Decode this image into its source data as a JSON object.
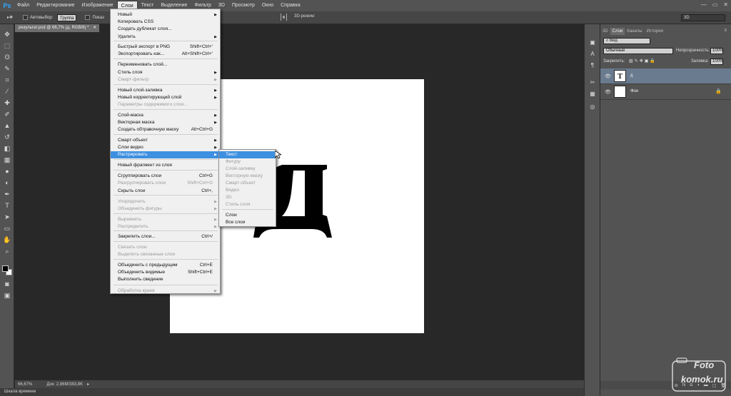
{
  "app": {
    "logo": "Ps",
    "window_buttons": [
      "—",
      "▭",
      "✕"
    ]
  },
  "menubar": {
    "items": [
      "Файл",
      "Редактирование",
      "Изображение",
      "Слои",
      "Текст",
      "Выделение",
      "Фильтр",
      "3D",
      "Просмотр",
      "Окно",
      "Справка"
    ],
    "active": "Слои"
  },
  "options_bar": {
    "auto_select_label": "Автовыбор:",
    "auto_select_value": "Группа",
    "show_controls_label": "Показ",
    "mode_3d_label": "3D-режим:",
    "workspace": "3D"
  },
  "document": {
    "tab_title": "результат.psd @ 66,7% (д, RGB/8) *",
    "close": "✕",
    "canvas_glyph": "д"
  },
  "status": {
    "zoom": "66,67%",
    "doc_info": "Док: 2,86M/383,8K",
    "timeline_label": "Шкала времени"
  },
  "layer_menu": {
    "items": [
      {
        "label": "Новый",
        "shortcut": "",
        "submenu": true,
        "disabled": false
      },
      {
        "label": "Копировать CSS",
        "shortcut": "",
        "submenu": false,
        "disabled": false
      },
      {
        "label": "Создать дубликат слоя...",
        "shortcut": "",
        "submenu": false,
        "disabled": false
      },
      {
        "label": "Удалить",
        "shortcut": "",
        "submenu": true,
        "disabled": false
      },
      {
        "label": "Быстрый экспорт в PNG",
        "shortcut": "Shift+Ctrl+'",
        "submenu": false,
        "disabled": false
      },
      {
        "label": "Экспортировать как...",
        "shortcut": "Alt+Shift+Ctrl+'",
        "submenu": false,
        "disabled": false
      },
      {
        "label": "Переименовать слой...",
        "shortcut": "",
        "submenu": false,
        "disabled": false
      },
      {
        "label": "Стиль слоя",
        "shortcut": "",
        "submenu": true,
        "disabled": false
      },
      {
        "label": "Смарт-фильтр",
        "shortcut": "",
        "submenu": true,
        "disabled": true
      },
      {
        "label": "Новый слой-заливка",
        "shortcut": "",
        "submenu": true,
        "disabled": false
      },
      {
        "label": "Новый корректирующий слой",
        "shortcut": "",
        "submenu": true,
        "disabled": false
      },
      {
        "label": "Параметры содержимого слоя...",
        "shortcut": "",
        "submenu": false,
        "disabled": true
      },
      {
        "label": "Слой-маска",
        "shortcut": "",
        "submenu": true,
        "disabled": false
      },
      {
        "label": "Векторная маска",
        "shortcut": "",
        "submenu": true,
        "disabled": false
      },
      {
        "label": "Создать обтравочную маску",
        "shortcut": "Alt+Ctrl+G",
        "submenu": false,
        "disabled": false
      },
      {
        "label": "Смарт-объект",
        "shortcut": "",
        "submenu": true,
        "disabled": false
      },
      {
        "label": "Слои видео",
        "shortcut": "",
        "submenu": true,
        "disabled": false
      },
      {
        "label": "Растрировать",
        "shortcut": "",
        "submenu": true,
        "disabled": false,
        "highlighted": true
      },
      {
        "label": "Новый фрагмент из слоя",
        "shortcut": "",
        "submenu": false,
        "disabled": false
      },
      {
        "label": "Сгруппировать слои",
        "shortcut": "Ctrl+G",
        "submenu": false,
        "disabled": false
      },
      {
        "label": "Разгруппировать слои",
        "shortcut": "Shift+Ctrl+G",
        "submenu": false,
        "disabled": true
      },
      {
        "label": "Скрыть слои",
        "shortcut": "Ctrl+,",
        "submenu": false,
        "disabled": false
      },
      {
        "label": "Упорядочить",
        "shortcut": "",
        "submenu": true,
        "disabled": true
      },
      {
        "label": "Объединить фигуры",
        "shortcut": "",
        "submenu": true,
        "disabled": true
      },
      {
        "label": "Выровнять",
        "shortcut": "",
        "submenu": true,
        "disabled": true
      },
      {
        "label": "Распределить",
        "shortcut": "",
        "submenu": true,
        "disabled": true
      },
      {
        "label": "Закрепить слои...",
        "shortcut": "Ctrl+/",
        "submenu": false,
        "disabled": false
      },
      {
        "label": "Связать слои",
        "shortcut": "",
        "submenu": false,
        "disabled": true
      },
      {
        "label": "Выделить связанные слои",
        "shortcut": "",
        "submenu": false,
        "disabled": true
      },
      {
        "label": "Объединить с предыдущим",
        "shortcut": "Ctrl+E",
        "submenu": false,
        "disabled": false
      },
      {
        "label": "Объединить видимые",
        "shortcut": "Shift+Ctrl+E",
        "submenu": false,
        "disabled": false
      },
      {
        "label": "Выполнить сведение",
        "shortcut": "",
        "submenu": false,
        "disabled": false
      },
      {
        "label": "Обработка краев",
        "shortcut": "",
        "submenu": true,
        "disabled": true
      }
    ]
  },
  "rasterize_submenu": {
    "items": [
      {
        "label": "Текст",
        "disabled": false,
        "highlighted": true
      },
      {
        "label": "Фигуру",
        "disabled": true
      },
      {
        "label": "Слой-заливку",
        "disabled": true
      },
      {
        "label": "Векторную маску",
        "disabled": true
      },
      {
        "label": "Смарт-объект",
        "disabled": true
      },
      {
        "label": "Видео",
        "disabled": true
      },
      {
        "label": "3D",
        "disabled": true
      },
      {
        "label": "Стиль слоя",
        "disabled": true
      },
      {
        "label": "Слои",
        "disabled": false
      },
      {
        "label": "Все слои",
        "disabled": false
      }
    ]
  },
  "layers_panel": {
    "tabs": [
      "3D",
      "Слои",
      "Каналы",
      "История"
    ],
    "active_tab": "Слои",
    "filter_kind": "Вид",
    "blend_mode": "Обычные",
    "opacity_label": "Непрозрачность:",
    "opacity_value": "100%",
    "lock_label": "Закрепить:",
    "fill_label": "Заливка:",
    "fill_value": "100%",
    "layers": [
      {
        "name": "д",
        "type": "text",
        "thumb": "T",
        "selected": true,
        "locked": false
      },
      {
        "name": "Фон",
        "type": "background",
        "thumb": "",
        "selected": false,
        "locked": true
      }
    ],
    "footer_icons": [
      "link-icon",
      "fx-icon",
      "mask-icon",
      "adjustment-icon",
      "folder-icon",
      "new-layer-icon",
      "trash-icon"
    ],
    "footer_labels": [
      "⊖",
      "fx",
      "◘",
      "◑",
      "▬",
      "▢",
      "🗑"
    ]
  },
  "watermark": {
    "line1": "Foto",
    "line2": "komok.ru"
  }
}
